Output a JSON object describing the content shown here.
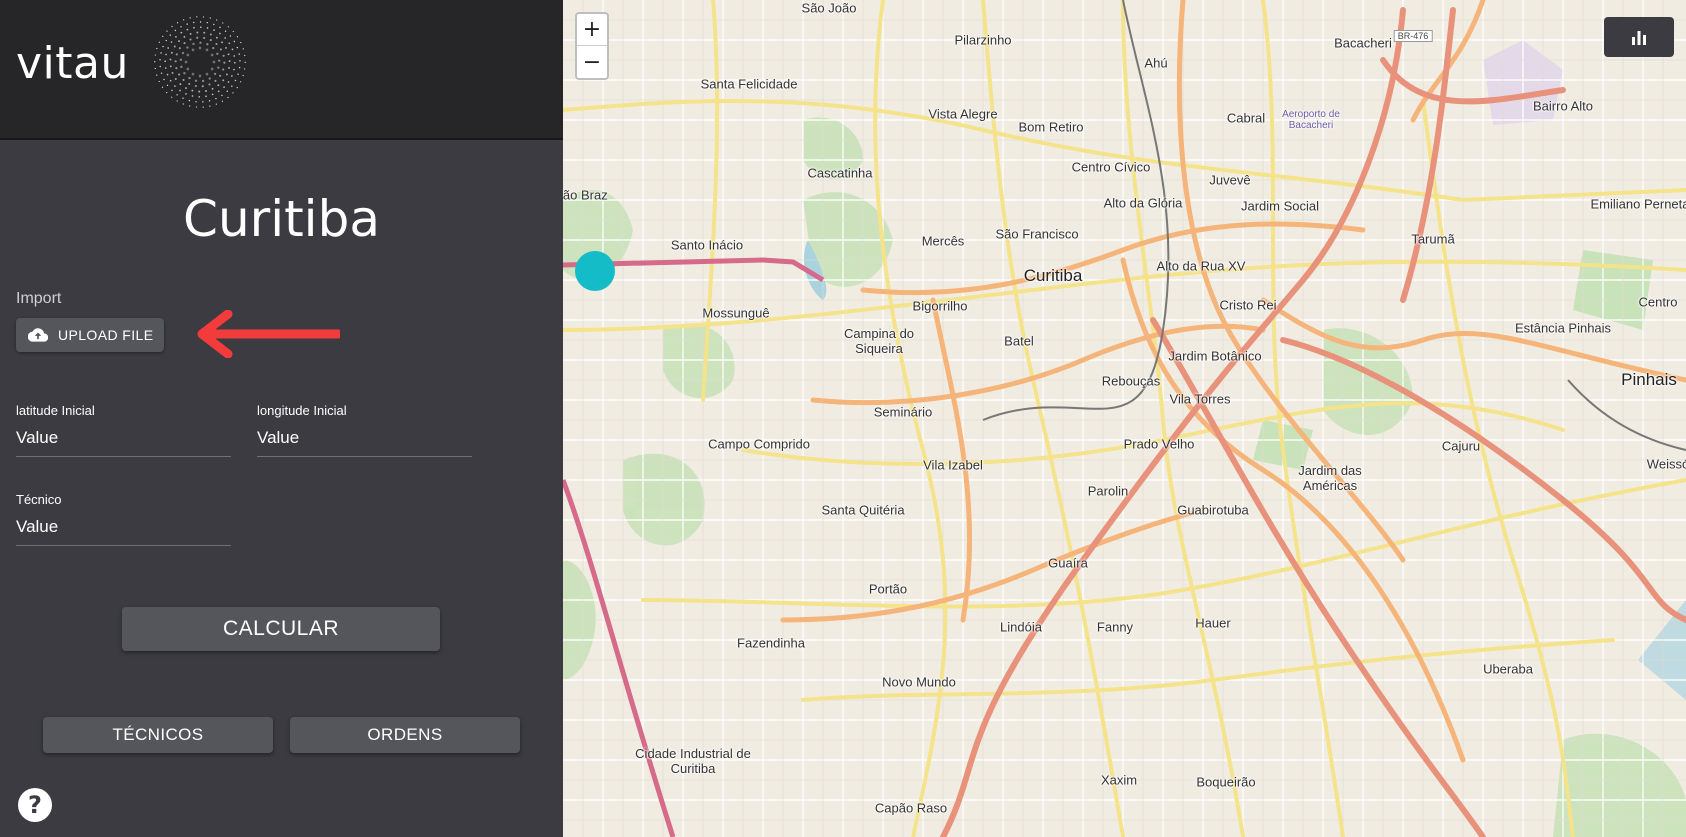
{
  "brand": {
    "name": "vitau"
  },
  "sidebar": {
    "city_title": "Curitiba",
    "import_label": "Import",
    "upload_button": "UPLOAD FILE",
    "fields": {
      "lat_label": "latitude Inicial",
      "lat_value": "Value",
      "lng_label": "longitude Inicial",
      "lng_value": "Value",
      "tech_label": "Técnico",
      "tech_value": "Value"
    },
    "calc_button": "CALCULAR",
    "tecnicos_button": "TÉCNICOS",
    "ordens_button": "ORDENS",
    "help_glyph": "?"
  },
  "map": {
    "zoom_in": "+",
    "zoom_out": "−",
    "marker_color": "#14bcc8",
    "labels": [
      "São João",
      "Pilarzinho",
      "Ahú",
      "Bacacheri",
      "Santa Felicidade",
      "Vista Alegre",
      "Cabral",
      "Bairro Alto",
      "Bom Retiro",
      "Cascatinha",
      "Centro Cívico",
      "Juvevê",
      "São Braz",
      "Alto da Glória",
      "Jardim Social",
      "Emiliano Perneta",
      "Santo Inácio",
      "Mercês",
      "São Francisco",
      "Tarumã",
      "Curitiba",
      "Alto da Rua XV",
      "Bigorrilho",
      "Mossunguê",
      "Cristo Rei",
      "Campina do Siqueira",
      "Estância Pinhais",
      "Batel",
      "Jardim Botânico",
      "Pinhais",
      "Rebouças",
      "Seminário",
      "Vila Torres",
      "Cajuru",
      "Campo Comprido",
      "Prado Velho",
      "Vila Izabel",
      "Weissó",
      "Jardim das Américas",
      "Parolin",
      "Santa Quitéria",
      "Guabirotuba",
      "Guaíra",
      "Portão",
      "Lindóia",
      "Fanny",
      "Hauer",
      "Fazendinha",
      "Uberaba",
      "Novo Mundo",
      "Cidade Industrial de Curitiba",
      "Xaxim",
      "Boqueirão",
      "Capão Raso",
      "Centro",
      "Aeroporto de Bacacheri",
      "BR-476"
    ]
  }
}
